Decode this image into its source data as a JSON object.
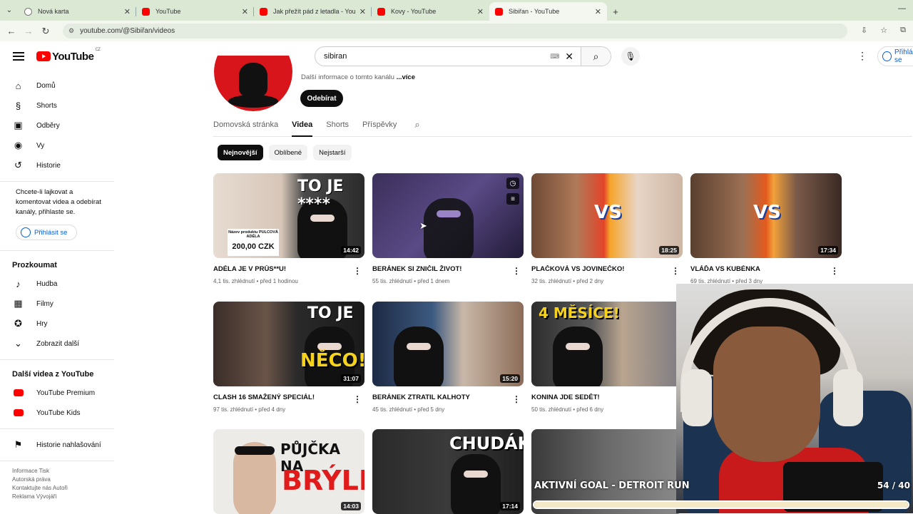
{
  "browser": {
    "tabs": [
      {
        "title": "Nová karta",
        "icon": "chrome-icon",
        "active": false
      },
      {
        "title": "YouTube",
        "icon": "youtube-icon",
        "active": false
      },
      {
        "title": "Jak přežít pád z letadla - YouTube",
        "icon": "youtube-icon",
        "active": false
      },
      {
        "title": "Kovy - YouTube",
        "icon": "youtube-icon",
        "active": false
      },
      {
        "title": "Sibiřan - YouTube",
        "icon": "youtube-icon",
        "active": true
      }
    ],
    "url": "youtube.com/@Sibiřan/videos"
  },
  "masthead": {
    "logo_text": "YouTube",
    "region": "CZ",
    "search_value": "sibiran",
    "signin_label": "Přihlásit se"
  },
  "sidebar": {
    "main": [
      {
        "label": "Domů",
        "icon": "home-icon"
      },
      {
        "label": "Shorts",
        "icon": "shorts-icon"
      },
      {
        "label": "Odběry",
        "icon": "subscriptions-icon"
      },
      {
        "label": "Vy",
        "icon": "user-icon"
      },
      {
        "label": "Historie",
        "icon": "history-icon"
      }
    ],
    "note": "Chcete-li lajkovat a komentovat videa a odebírat kanály, přihlaste se.",
    "signin_label": "Přihlásit se",
    "explore_heading": "Prozkoumat",
    "explore": [
      {
        "label": "Hudba",
        "icon": "music-icon"
      },
      {
        "label": "Filmy",
        "icon": "film-icon"
      },
      {
        "label": "Hry",
        "icon": "gamepad-icon"
      },
      {
        "label": "Zobrazit další",
        "icon": "chevron-down-icon"
      }
    ],
    "more_heading": "Další videa z YouTube",
    "more": [
      {
        "label": "YouTube Premium"
      },
      {
        "label": "YouTube Kids"
      }
    ],
    "report_label": "Historie nahlašování",
    "footer_line1": "Informace  Tisk",
    "footer_line2": "Autorská práva",
    "footer_line3": "Kontaktujte nás  Autoři",
    "footer_line4": "Reklama  Vývojáři"
  },
  "channel": {
    "more_info": "Další informace o tomto kanálu ",
    "more_link": "...více",
    "subscribe_label": "Odebírat",
    "tabs": [
      "Domovská stránka",
      "Videa",
      "Shorts",
      "Příspěvky"
    ],
    "active_tab": "Videa",
    "chips": [
      "Nejnovější",
      "Oblíbené",
      "Nejstarší"
    ],
    "active_chip": "Nejnovější"
  },
  "videos": [
    {
      "title": "ADÉLA JE V PRŮS**U!",
      "meta": "4,1 tis. zhlédnutí • před 1 hodinou",
      "duration": "14:42",
      "thumb_text": "TO JE ****",
      "price_label": "Název produktu PULCOVÁ ADÉLA",
      "price": "200,00 CZK"
    },
    {
      "title": "BERÁNEK SI ZNIČIL ŽIVOT!",
      "meta": "55 tis. zhlédnutí • před 1 dnem",
      "duration": ""
    },
    {
      "title": "PLAČKOVÁ VS JOVINEČKO!",
      "meta": "32 tis. zhlédnutí • před 2 dny",
      "duration": "18:25",
      "thumb_text": "VS"
    },
    {
      "title": "VLÁĎA VS KUBÉNKA",
      "meta": "69 tis. zhlédnutí • před 3 dny",
      "duration": "17:34",
      "thumb_text": "VS"
    },
    {
      "title": "CLASH 16 SMAŽENÝ SPECIÁL!",
      "meta": "97 tis. zhlédnutí • před 4 dny",
      "duration": "31:07",
      "thumb_text": "TO JE",
      "thumb_text2": "NĚCO!"
    },
    {
      "title": "BERÁNEK ZTRATIL KALHOTY",
      "meta": "45 tis. zhlédnutí • před 5 dny",
      "duration": "15:20"
    },
    {
      "title": "KONINA JDE SEDĚT!",
      "meta": "50 tis. zhlédnutí • před 6 dny",
      "duration": "",
      "thumb_text": "4 MĚSÍCE!"
    },
    {
      "title": "",
      "meta": "",
      "duration": ""
    },
    {
      "title": "",
      "meta": "",
      "duration": "14:03",
      "thumb_text": "PŮJČKA NA",
      "thumb_text2": "BRÝLE"
    },
    {
      "title": "",
      "meta": "",
      "duration": "17:14",
      "thumb_text": "CHUDÁK"
    }
  ],
  "stream_overlay": {
    "goal_text": "AKTIVNÍ GOAL - DETROIT RUN",
    "goal_count": "54 / 40",
    "goal_progress": 1.0
  },
  "colors": {
    "youtube_red": "#ff0000",
    "link_blue": "#065fd4",
    "chrome_green": "#dbe8d4"
  }
}
